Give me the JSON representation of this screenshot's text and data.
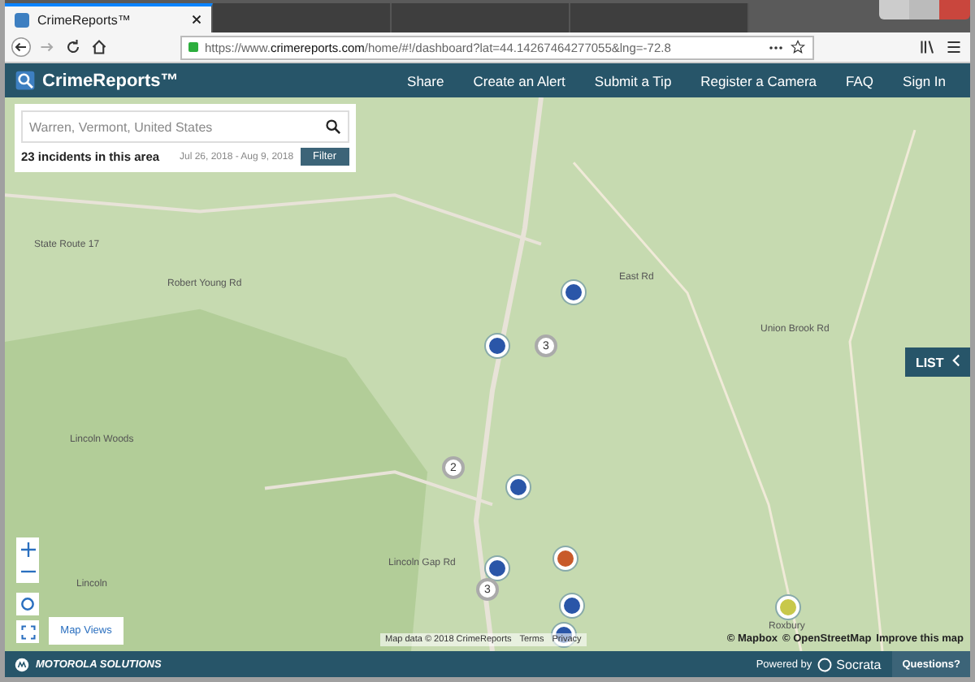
{
  "browser": {
    "tabs": [
      {
        "title": "CrimeReports™",
        "selected": true
      },
      {
        "selected": false
      },
      {
        "selected": false
      },
      {
        "selected": false
      }
    ],
    "url": {
      "prefix": "https://www.",
      "domain": "crimereports.com",
      "rest": "/home/#!/dashboard?lat=44.14267464277055&lng=-72.8"
    }
  },
  "app": {
    "brand": "CrimeReports™",
    "nav": [
      "Share",
      "Create an Alert",
      "Submit a Tip",
      "Register a Camera",
      "FAQ",
      "Sign In"
    ]
  },
  "search": {
    "value": "Warren, Vermont, United States",
    "incident_count": "23 incidents in this area",
    "date_range": "Jul 26, 2018 - Aug 9, 2018",
    "filter_button": "Filter"
  },
  "map": {
    "labels": [
      "Robert Young Rd",
      "Lincoln Woods",
      "Lincoln",
      "East Rd",
      "Roxbury",
      "Union Brook Rd",
      "Lincoln Gap Rd",
      "State Route 17"
    ],
    "markers": [
      {
        "kind": "incident",
        "color": "#2a56a8"
      },
      {
        "kind": "incident",
        "color": "#2a56a8"
      },
      {
        "kind": "cluster",
        "count": "3"
      },
      {
        "kind": "cluster",
        "count": "2"
      },
      {
        "kind": "incident",
        "color": "#2a56a8"
      },
      {
        "kind": "incident",
        "color": "#2a56a8"
      },
      {
        "kind": "cluster",
        "count": "3"
      },
      {
        "kind": "incident",
        "color": "#c85a2a"
      },
      {
        "kind": "incident",
        "color": "#2a56a8"
      },
      {
        "kind": "incident",
        "color": "#2a56a8"
      },
      {
        "kind": "incident",
        "color": "#c8c84a"
      }
    ],
    "list_button": "LIST",
    "map_views_button": "Map Views",
    "attribution": {
      "map_data": "Map data © 2018 CrimeReports",
      "terms": "Terms",
      "privacy": "Privacy",
      "mapbox": "© Mapbox",
      "osm": "© OpenStreetMap",
      "improve": "Improve this map"
    }
  },
  "footer": {
    "brand": "MOTOROLA SOLUTIONS",
    "powered_by": "Powered by",
    "provider": "Socrata",
    "questions": "Questions?"
  }
}
